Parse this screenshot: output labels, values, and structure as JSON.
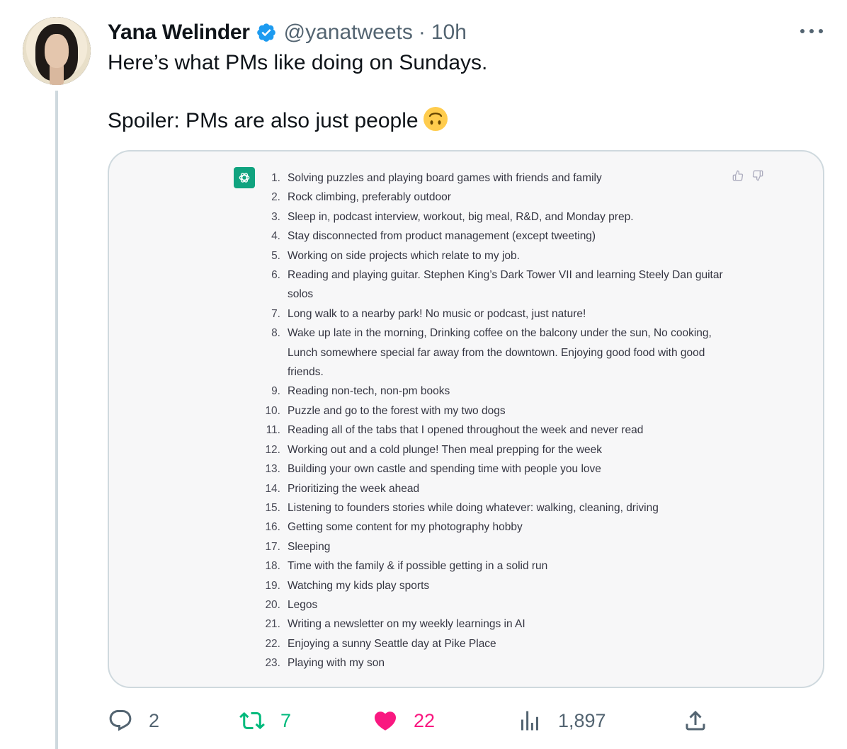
{
  "author": {
    "name": "Yana Welinder",
    "handle": "@yanatweets",
    "separator": "·",
    "time": "10h"
  },
  "tweet": {
    "line1": "Here’s what PMs like doing on Sundays.",
    "line2": "Spoiler: PMs are also just people"
  },
  "list": [
    {
      "num": "1.",
      "text": "Solving puzzles and playing board games with friends and family"
    },
    {
      "num": "2.",
      "text": "Rock climbing, preferably outdoor"
    },
    {
      "num": "3.",
      "text": "Sleep in, podcast interview, workout, big meal, R&D, and Monday prep."
    },
    {
      "num": "4.",
      "text": "Stay disconnected from product management (except tweeting)"
    },
    {
      "num": "5.",
      "text": "Working on side projects which relate to my job."
    },
    {
      "num": "6.",
      "text": "Reading and playing guitar. Stephen King’s Dark Tower VII and learning Steely Dan guitar solos"
    },
    {
      "num": "7.",
      "text": "Long walk to a nearby park! No music or podcast, just nature!"
    },
    {
      "num": "8.",
      "text": "Wake up late in the morning, Drinking coffee on the balcony under the sun, No cooking, Lunch somewhere special far away from the downtown. Enjoying good food with good friends."
    },
    {
      "num": "9.",
      "text": "Reading non-tech, non-pm books"
    },
    {
      "num": "10.",
      "text": "Puzzle and go to the forest with my two dogs"
    },
    {
      "num": "11.",
      "text": "Reading all of the tabs that I opened throughout the week and never read"
    },
    {
      "num": "12.",
      "text": "Working out and a cold plunge! Then meal prepping for the week"
    },
    {
      "num": "13.",
      "text": "Building your own castle and spending time with people you love"
    },
    {
      "num": "14.",
      "text": "Prioritizing the week ahead"
    },
    {
      "num": "15.",
      "text": "Listening to founders stories while doing whatever: walking, cleaning, driving"
    },
    {
      "num": "16.",
      "text": "Getting some content for my photography hobby"
    },
    {
      "num": "17.",
      "text": "Sleeping"
    },
    {
      "num": "18.",
      "text": "Time with the family & if possible getting in a solid run"
    },
    {
      "num": "19.",
      "text": "Watching my kids play sports"
    },
    {
      "num": "20.",
      "text": "Legos"
    },
    {
      "num": "21.",
      "text": "Writing a newsletter on my weekly learnings in AI"
    },
    {
      "num": "22.",
      "text": "Enjoying a sunny Seattle day at Pike Place"
    },
    {
      "num": "23.",
      "text": "Playing with my son"
    }
  ],
  "actions": {
    "replies": "2",
    "retweets": "7",
    "likes": "22",
    "views": "1,897"
  },
  "colors": {
    "verified": "#1d9bf0",
    "retweet": "#00ba7c",
    "like": "#f91880",
    "gpt_logo": "#10a37f"
  }
}
